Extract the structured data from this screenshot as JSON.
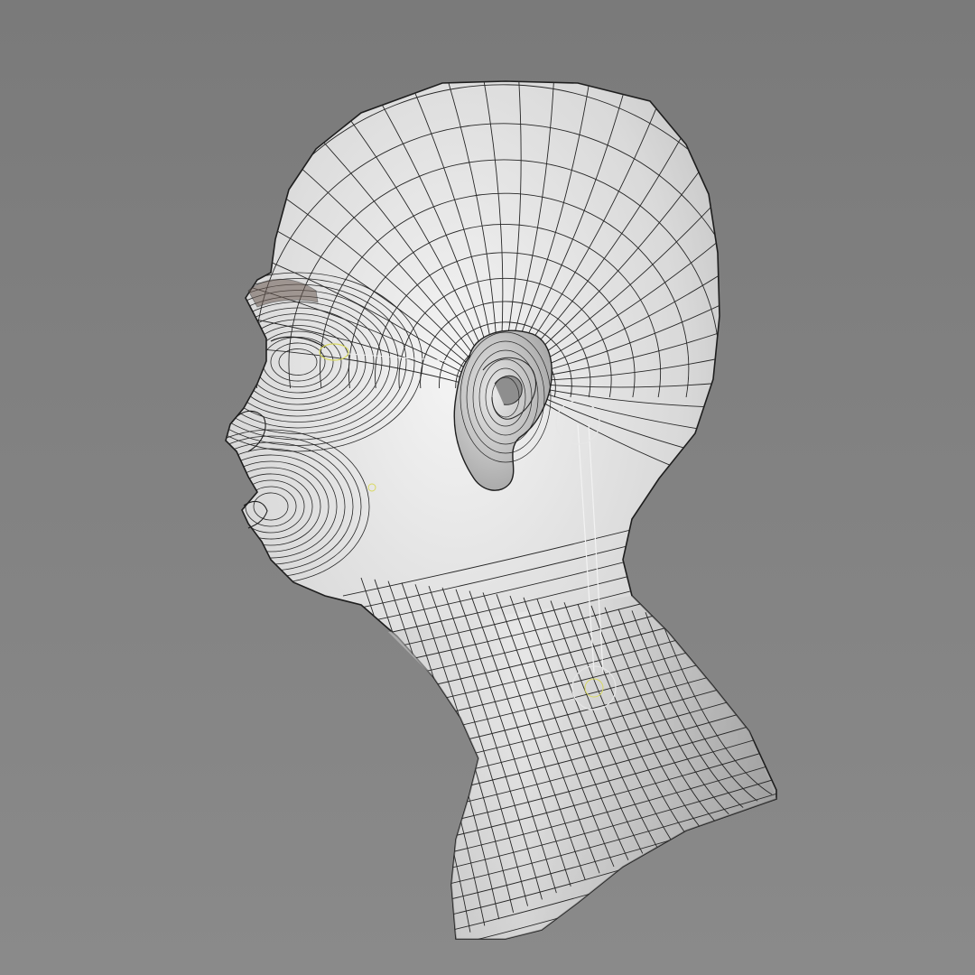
{
  "viewport": {
    "background_top": "#7a7a7a",
    "background_bottom": "#8a8a8a",
    "mesh_fill_light": "#f4f4f4",
    "mesh_fill_mid": "#d9d9d9",
    "mesh_fill_dark": "#a8a8a8",
    "wire_color": "#262626",
    "gizmo_color": "#e6e6e6",
    "gizmo_accent": "#d8d860",
    "model_icon": "head-mesh-icon"
  }
}
